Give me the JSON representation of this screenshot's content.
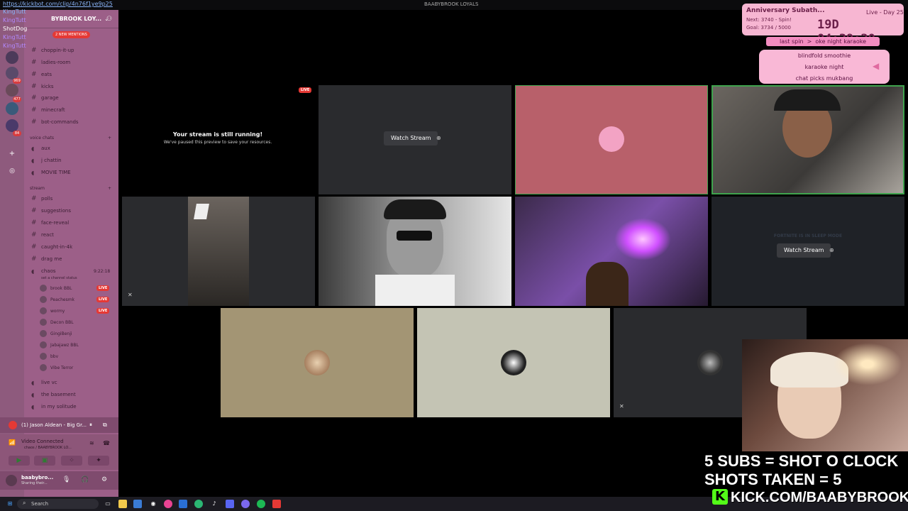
{
  "titlebar": {
    "clip_url": "https://kickbot.com/clip/4n76f1ye9p25",
    "window_title": "BAABYBROOK LOYALS"
  },
  "server": {
    "name": "BYBROOK LOY...",
    "mentions": "2 NEW MENTIONS"
  },
  "overlay_users": [
    "KingTutt",
    "KingTutt",
    "ShotDog",
    "KingTutt",
    "KingTutt"
  ],
  "channels": [
    {
      "label": "choppin-it-up",
      "top": 0
    },
    {
      "label": "ladies-room"
    },
    {
      "label": "eats"
    },
    {
      "label": "kicks"
    },
    {
      "label": "garage"
    },
    {
      "label": "minecraft"
    },
    {
      "label": "bot-commands"
    }
  ],
  "cat_voice": "voice chats",
  "voice_channels": [
    "aux",
    "j chattin",
    "MOVIE TIME"
  ],
  "cat_stream": "stream",
  "stream_channels": [
    "polls",
    "suggestions",
    "face-reveal",
    "react",
    "caught-in-4k",
    "drag me"
  ],
  "chaos": {
    "label": "chaos",
    "timer": "9:22:18",
    "status": "Set a channel status"
  },
  "voice_users": [
    {
      "name": "brook",
      "tag": "BBL",
      "live": "LIVE"
    },
    {
      "name": "Peachesmk",
      "tag": "",
      "live": "LIVE"
    },
    {
      "name": "wormy",
      "tag": "",
      "live": "LIVE"
    },
    {
      "name": "Decon",
      "tag": "BBL",
      "live": ""
    },
    {
      "name": "GingiBenji",
      "tag": "",
      "live": ""
    },
    {
      "name": "Jabajawz",
      "tag": "BBL",
      "live": ""
    },
    {
      "name": "bbv",
      "tag": "",
      "live": ""
    },
    {
      "name": "Vibe Terror",
      "tag": "",
      "live": ""
    }
  ],
  "more_channels": [
    "live vc",
    "the basement",
    "in my solitude"
  ],
  "now_playing": "(1) Jason Aldean - Big Gr...",
  "voice_connection": {
    "title": "Video Connected",
    "subtitle": "chaos / BAABYBROOK LO..."
  },
  "user": {
    "name": "baabybro...",
    "status": "Sharing their..."
  },
  "taskbar": {
    "search": "Search"
  },
  "stream_preview": {
    "title": "Your stream is still running!",
    "subtitle": "We've paused this preview to save your resources.",
    "live": "LIVE"
  },
  "watch_stream_label": "Watch Stream",
  "fortnite_tile": "FORTNITE IS IN SLEEP MODE",
  "anniversary": {
    "title": "Anniversary Subath...",
    "day": "Live - Day 25",
    "next": "Next: 3740 - Spin!",
    "goal": "Goal: 3734 / 5000",
    "timer": "19D 04:39:20"
  },
  "spin": {
    "last": "last spin",
    "arrow": ">",
    "result": "oke night karaoke"
  },
  "wheel_items": [
    "blindfold smoothie",
    "karaoke night",
    "chat picks mukbang"
  ],
  "overlay": {
    "line1": "5 SUBS = SHOT O CLOCK",
    "line2": "SHOTS TAKEN = 5",
    "kick": "KICK.COM/BAABYBROOK"
  },
  "colors": {
    "live": "#e53935",
    "sidebar": "#9c5f88",
    "rail": "#8e5a7d",
    "kick_green": "#53fc18"
  }
}
